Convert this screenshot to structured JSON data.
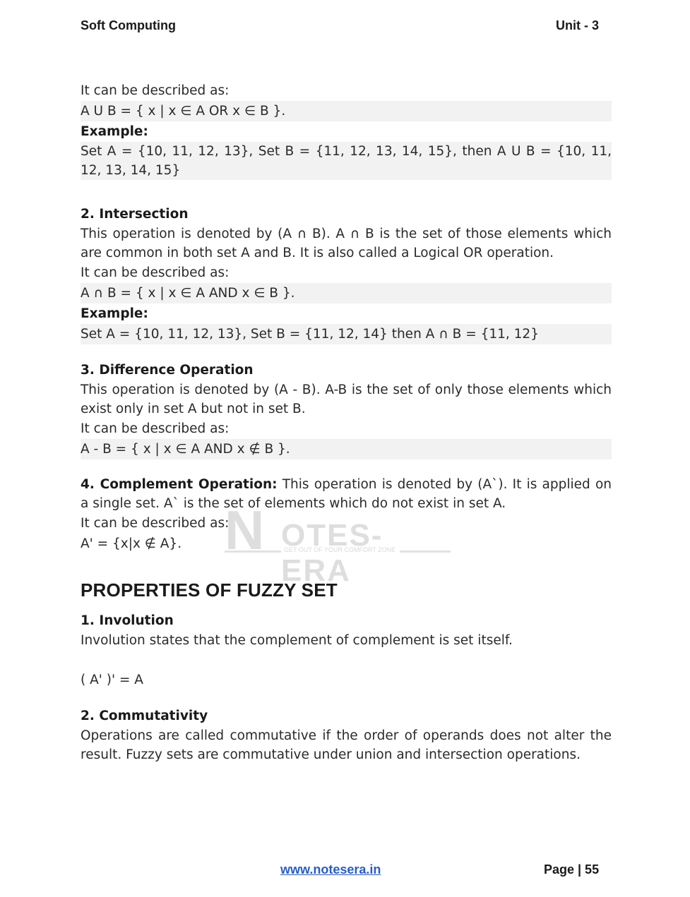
{
  "header": {
    "left": "Soft Computing",
    "right": "Unit - 3"
  },
  "union": {
    "desc_intro": "It can be described as:",
    "formula": "A U B = { x | x ∈ A OR x ∈ B }.",
    "example_label": "Example:",
    "example_text": "Set A = {10, 11, 12, 13}, Set B = {11, 12, 13, 14, 15}, then A U B = {10, 11, 12, 13, 14, 15}"
  },
  "intersection": {
    "heading": "2. Intersection",
    "body": "This operation is denoted by (A ∩ B). A ∩ B is the set of those elements which are common in both set A and B. It is also called a Logical OR operation.",
    "desc_intro": "It can be described as:",
    "formula": "A ∩ B = { x | x ∈ A AND x ∈ B }.",
    "example_label": "Example:",
    "example_text": "Set A = {10, 11, 12, 13}, Set B = {11, 12, 14} then A ∩ B = {11, 12}"
  },
  "difference": {
    "heading": "3. Difference Operation",
    "body": "This operation is denoted by (A - B). A-B is the set of only those elements which exist only in set A but not in set B.",
    "desc_intro": "It can be described as:",
    "formula": "A - B = { x | x ∈ A AND x ∉ B }."
  },
  "complement": {
    "heading": "4. Complement Operation:",
    "body": " This operation is denoted by (A`). It is applied on a single set. A` is the set of elements which do not exist in set A.",
    "desc_intro": "It can be described as:",
    "formula": "A' = {x|x ∉ A}."
  },
  "properties": {
    "heading": "PROPERTIES OF FUZZY SET",
    "involution_heading": "1. Involution",
    "involution_body": "Involution states that the complement of complement is set itself.",
    "involution_formula": "( A' )' = A",
    "commutativity_heading": "2. Commutativity",
    "commutativity_body": "Operations are called commutative if the order of operands does not alter the result. Fuzzy sets are commutative under union and intersection operations."
  },
  "watermark": {
    "letter": "N",
    "text": "OTES-ERA",
    "tagline": "GET OUT OF YOUR COMFORT ZONE"
  },
  "footer": {
    "link": "www.notesera.in",
    "page": "Page | 55"
  }
}
